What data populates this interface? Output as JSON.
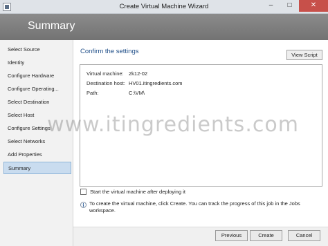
{
  "window": {
    "title": "Create Virtual Machine Wizard",
    "minimize_glyph": "–",
    "maximize_glyph": "□",
    "close_glyph": "✕"
  },
  "banner": {
    "heading": "Summary"
  },
  "sidebar": {
    "items": [
      {
        "label": "Select Source",
        "active": false
      },
      {
        "label": "Identity",
        "active": false
      },
      {
        "label": "Configure Hardware",
        "active": false
      },
      {
        "label": "Configure Operating...",
        "active": false
      },
      {
        "label": "Select Destination",
        "active": false
      },
      {
        "label": "Select Host",
        "active": false
      },
      {
        "label": "Configure Settings",
        "active": false
      },
      {
        "label": "Select Networks",
        "active": false
      },
      {
        "label": "Add Properties",
        "active": false
      },
      {
        "label": "Summary",
        "active": true
      }
    ]
  },
  "main": {
    "section_title": "Confirm the settings",
    "view_script_label": "View Script",
    "summary": [
      {
        "label": "Virtual machine:",
        "value": "2k12-02"
      },
      {
        "label": "Destination host:",
        "value": "HV01.itingredients.com"
      },
      {
        "label": "Path:",
        "value": "C:\\VM\\"
      }
    ],
    "start_vm": {
      "label": "Start the virtual machine after deploying it",
      "checked": false
    },
    "info": {
      "icon": "info-icon",
      "glyph": "i",
      "text": "To create the virtual machine, click Create. You can track the progress of this job in the Jobs workspace."
    }
  },
  "footer": {
    "previous_label": "Previous",
    "create_label": "Create",
    "cancel_label": "Cancel"
  },
  "watermark": {
    "text": "www.itingredients.com"
  },
  "colors": {
    "banner": "#7f7f7f",
    "section_title": "#1f4e88",
    "active_nav_bg": "#c9dcef",
    "close_button": "#c7504a"
  }
}
